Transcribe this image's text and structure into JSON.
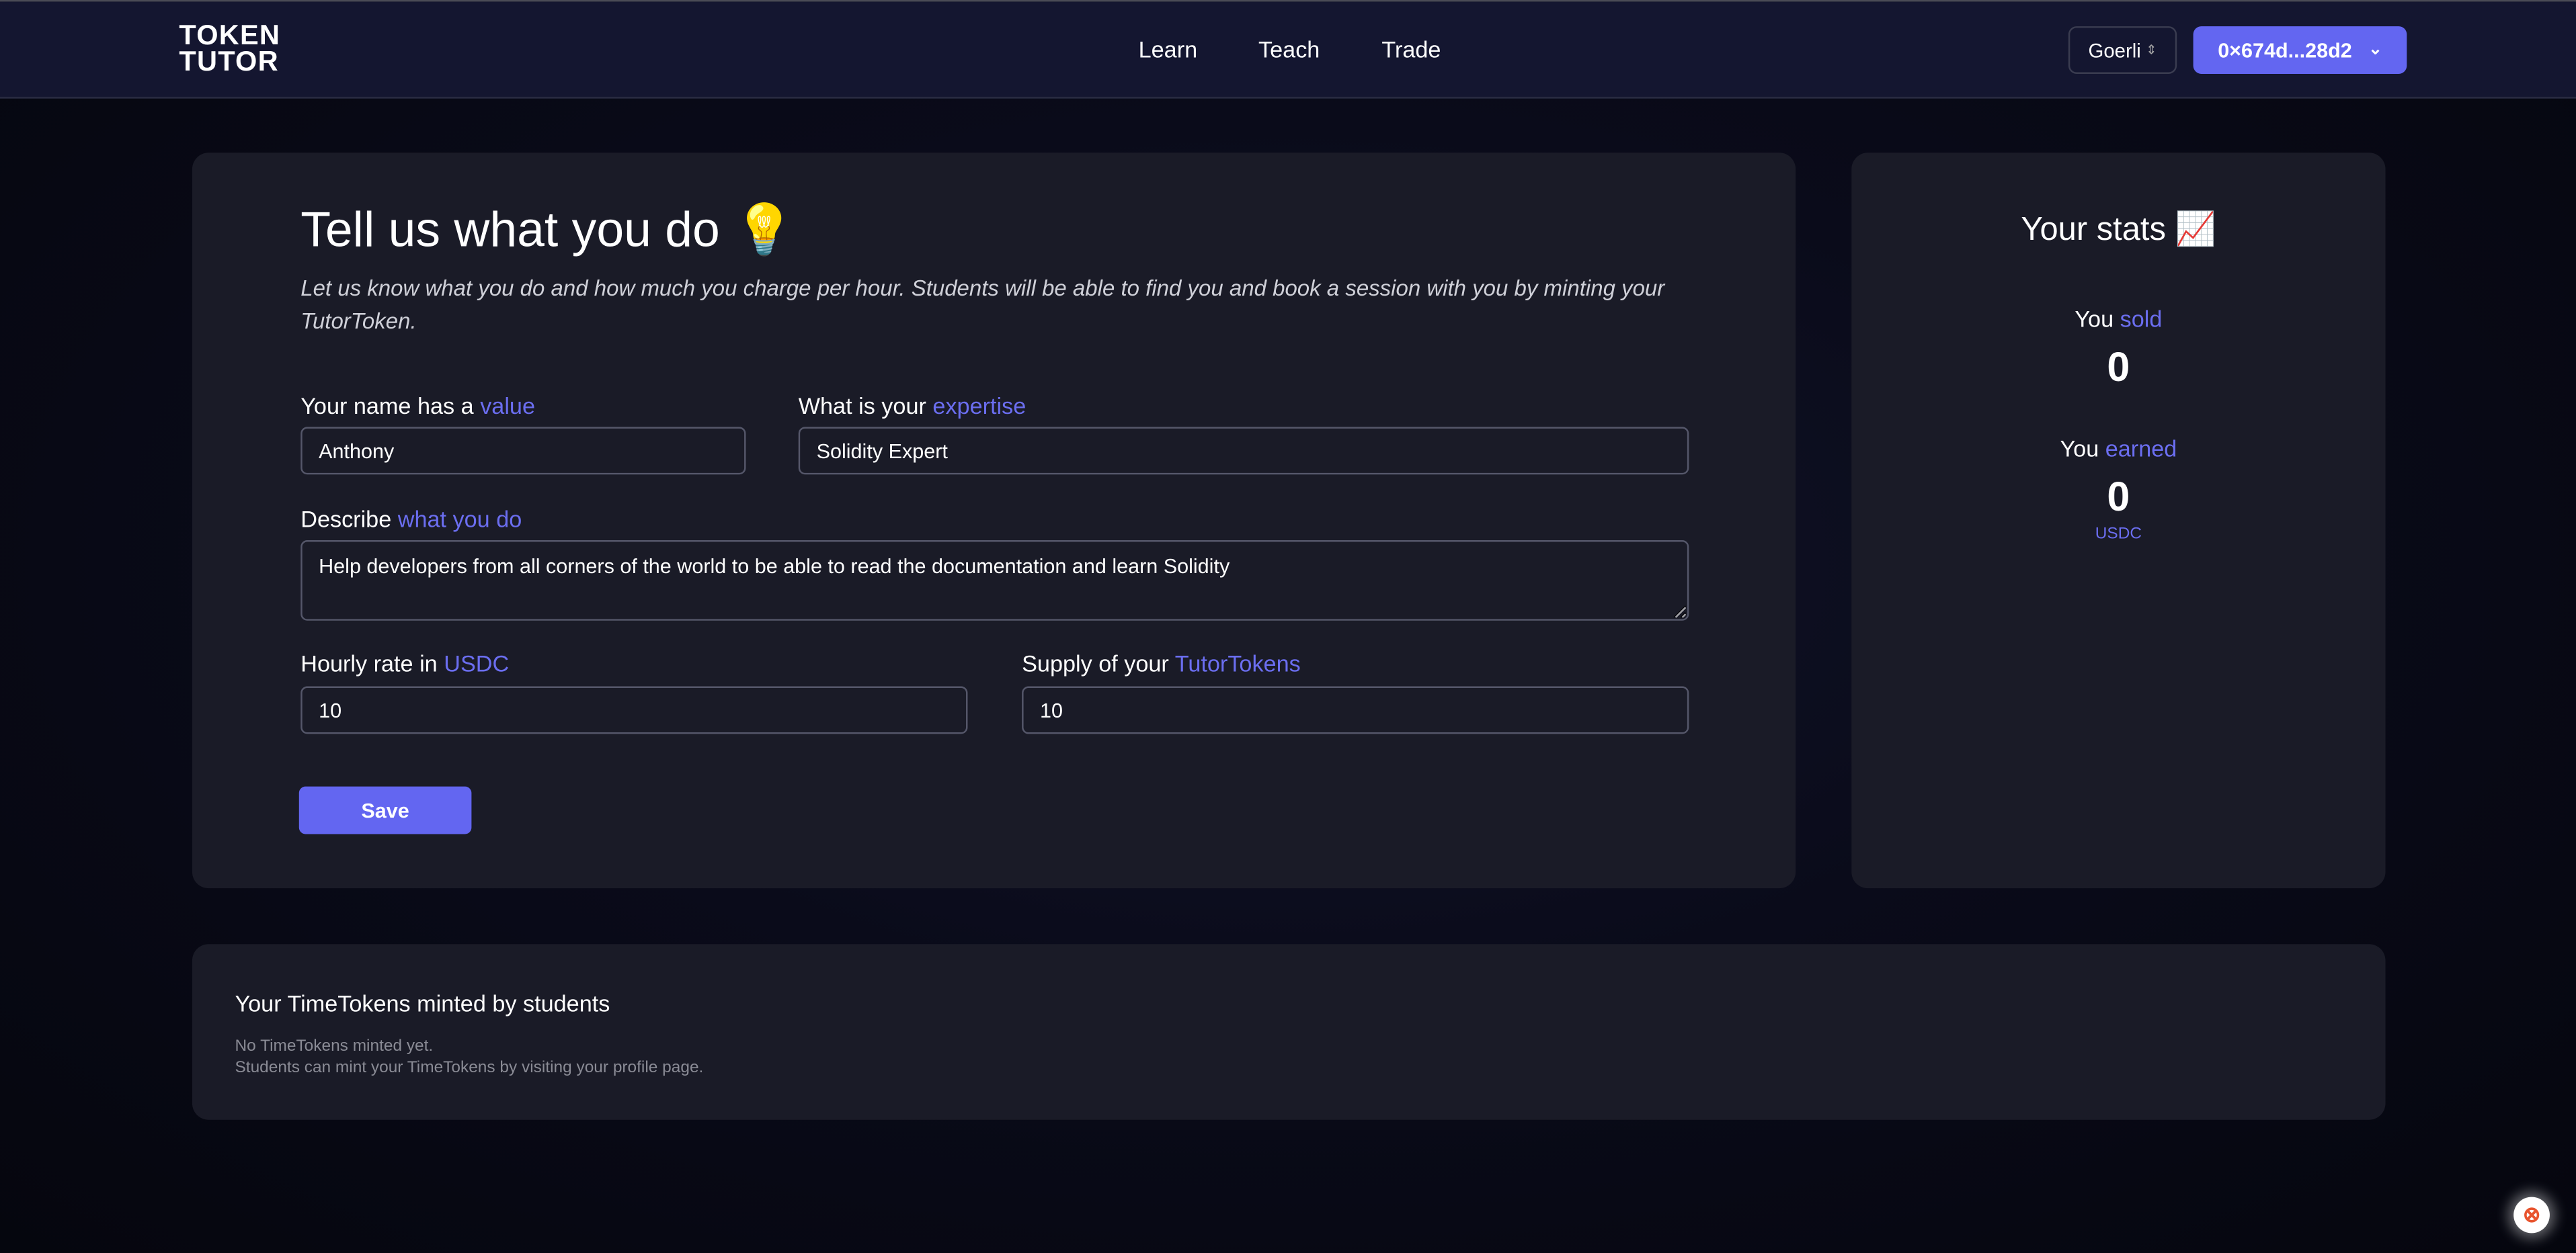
{
  "header": {
    "logo_line1": "TOKEN",
    "logo_line2": "TUTOR",
    "nav": [
      "Learn",
      "Teach",
      "Trade"
    ],
    "network": "Goerli",
    "address": "0×674d...28d2"
  },
  "form": {
    "title": "Tell us what you do 💡",
    "subtitle": "Let us know what you do and how much you charge per hour. Students will be able to find you and book a session with you by minting your TutorToken.",
    "name_label": "Your name has a ",
    "name_label_accent": "value",
    "name_value": "Anthony",
    "expertise_label": "What is your ",
    "expertise_label_accent": "expertise",
    "expertise_value": "Solidity Expert",
    "describe_label": "Describe ",
    "describe_label_accent": "what you do",
    "describe_value": "Help developers from all corners of the world to be able to read the documentation and learn Solidity",
    "rate_label": "Hourly rate in ",
    "rate_label_accent": "USDC",
    "rate_value": "10",
    "supply_label": "Supply of your ",
    "supply_label_accent": "TutorTokens",
    "supply_value": "10",
    "save": "Save"
  },
  "stats": {
    "title": "Your stats 📈",
    "sold_prefix": "You ",
    "sold_accent": "sold",
    "sold_value": "0",
    "earned_prefix": "You ",
    "earned_accent": "earned",
    "earned_value": "0",
    "earned_unit": "USDC"
  },
  "minted": {
    "title": "Your TimeTokens minted by students",
    "empty_line1": "No TimeTokens minted yet.",
    "empty_line2": "Students can mint your TimeTokens by visiting your profile page."
  },
  "colors": {
    "accent": "#6366f1",
    "card": "#1a1b27",
    "header": "#141630"
  },
  "icons": {
    "network_chevron": "chevron-up-down-icon",
    "address_chevron": "chevron-down-icon",
    "help": "support-chat-icon"
  }
}
